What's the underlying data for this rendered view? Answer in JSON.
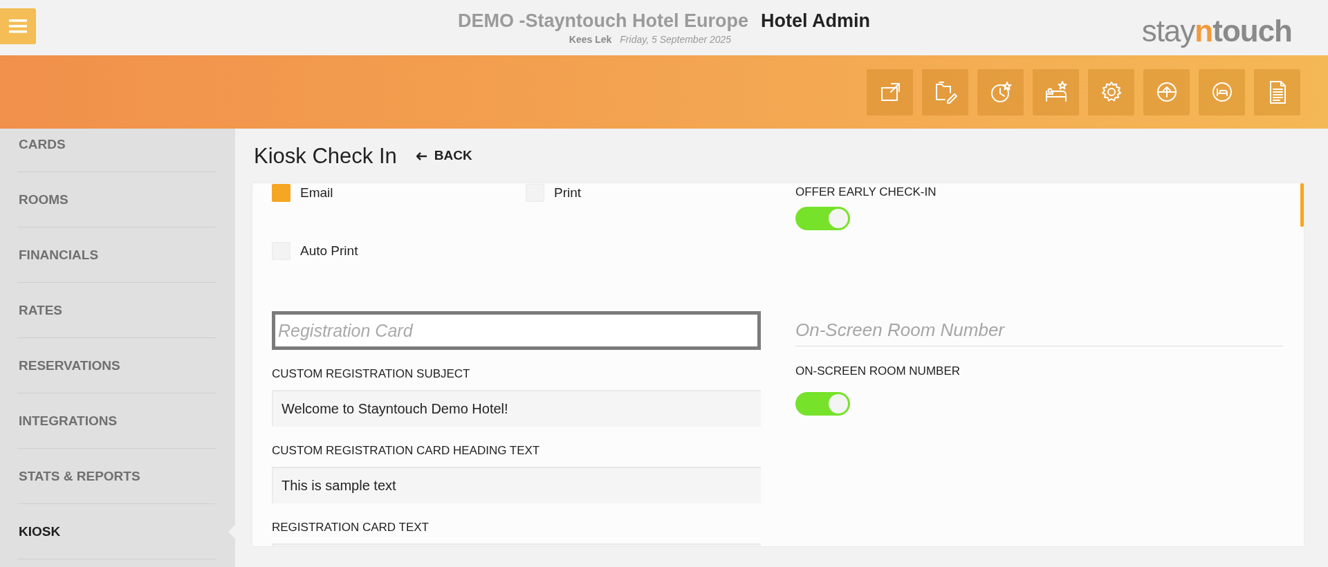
{
  "header": {
    "hotel": "DEMO -Stayntouch Hotel Europe",
    "app": "Hotel Admin",
    "user": "Kees Lek",
    "date": "Friday, 5 September 2025",
    "logo": [
      {
        "text": "stay",
        "kind": "light"
      },
      {
        "text": "n",
        "kind": "accent"
      },
      {
        "text": "touch",
        "kind": "bold"
      }
    ]
  },
  "sidebar": {
    "items": [
      {
        "label": "CARDS",
        "selected": false
      },
      {
        "label": "ROOMS",
        "selected": false
      },
      {
        "label": "FINANCIALS",
        "selected": false
      },
      {
        "label": "RATES",
        "selected": false
      },
      {
        "label": "RESERVATIONS",
        "selected": false
      },
      {
        "label": "INTEGRATIONS",
        "selected": false
      },
      {
        "label": "STATS & REPORTS",
        "selected": false
      },
      {
        "label": "KIOSK",
        "selected": true
      }
    ]
  },
  "page": {
    "title": "Kiosk Check In",
    "back": "BACK"
  },
  "checkboxes": [
    {
      "label": "Email",
      "checked": true
    },
    {
      "label": "Print",
      "checked": false
    },
    {
      "label": "Auto Print",
      "checked": false
    }
  ],
  "early_checkin": {
    "label": "OFFER EARLY CHECK-IN",
    "on": true
  },
  "registration_card": {
    "placeholder": "Registration Card",
    "focused": true,
    "fields": [
      {
        "label": "CUSTOM REGISTRATION SUBJECT",
        "value": "Welcome to Stayntouch Demo Hotel!"
      },
      {
        "label": "CUSTOM REGISTRATION CARD HEADING TEXT",
        "value": "This is sample text"
      },
      {
        "label": "REGISTRATION CARD TEXT"
      }
    ]
  },
  "room_number": {
    "heading": "On-Screen Room Number",
    "label": "ON-SCREEN ROOM NUMBER",
    "on": true
  }
}
